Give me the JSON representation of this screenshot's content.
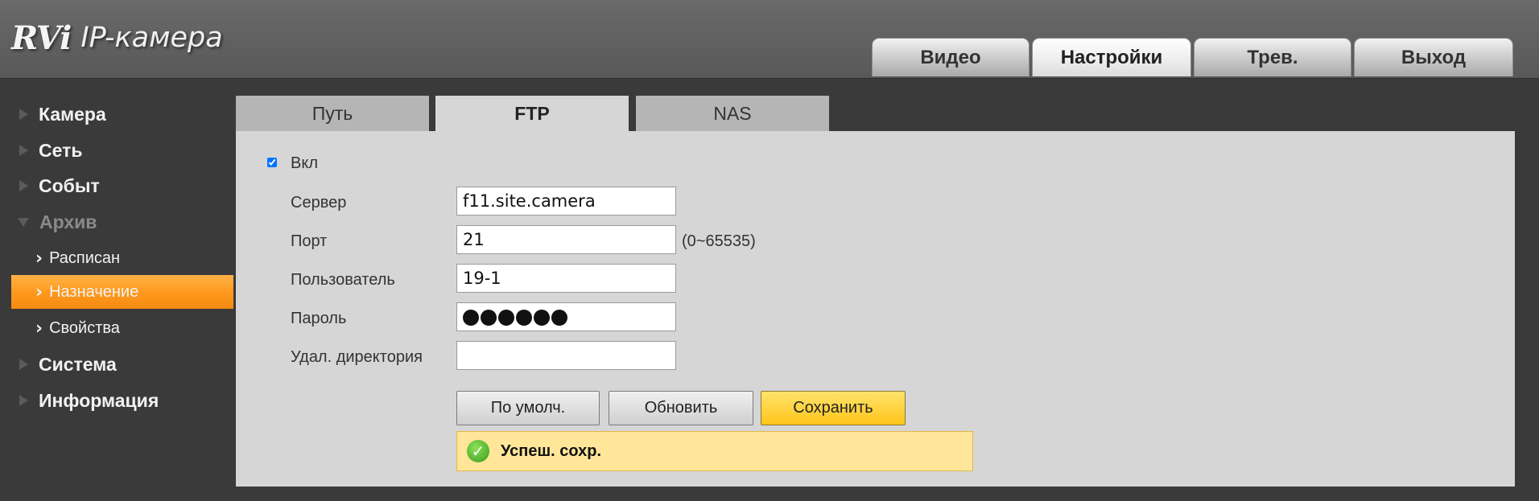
{
  "header": {
    "logo_mark": "RVi",
    "logo_text": "IP-камера",
    "tabs": [
      {
        "label": "Видео",
        "active": false
      },
      {
        "label": "Настройки",
        "active": true
      },
      {
        "label": "Трев.",
        "active": false
      },
      {
        "label": "Выход",
        "active": false
      }
    ]
  },
  "sidebar": {
    "items": [
      {
        "label": "Камера",
        "expanded": false
      },
      {
        "label": "Сеть",
        "expanded": false
      },
      {
        "label": "Событ",
        "expanded": false
      },
      {
        "label": "Архив",
        "expanded": true
      },
      {
        "label": "Система",
        "expanded": false
      },
      {
        "label": "Информация",
        "expanded": false
      }
    ],
    "subitems": [
      {
        "label": "Расписан",
        "active": false
      },
      {
        "label": "Назначение",
        "active": true
      },
      {
        "label": "Свойства",
        "active": false
      }
    ]
  },
  "subtabs": [
    {
      "label": "Путь",
      "active": false
    },
    {
      "label": "FTP",
      "active": true
    },
    {
      "label": "NAS",
      "active": false
    }
  ],
  "form": {
    "enable_label": "Вкл",
    "enable_checked": true,
    "server_label": "Сервер",
    "server_value": "f11.site.camera",
    "port_label": "Порт",
    "port_value": "21",
    "port_hint": "(0~65535)",
    "user_label": "Пользователь",
    "user_value": "19-1",
    "password_label": "Пароль",
    "password_value": "●●●●●●",
    "remote_dir_label": "Удал. директория",
    "remote_dir_value": ""
  },
  "buttons": {
    "default_label": "По умолч.",
    "refresh_label": "Обновить",
    "save_label": "Сохранить"
  },
  "status": {
    "message": "Успеш. сохр.",
    "icon": "check-circle-icon"
  },
  "colors": {
    "accent_orange": "#ff9a1f",
    "save_yellow": "#ffc51a",
    "message_bg": "#ffe698"
  }
}
